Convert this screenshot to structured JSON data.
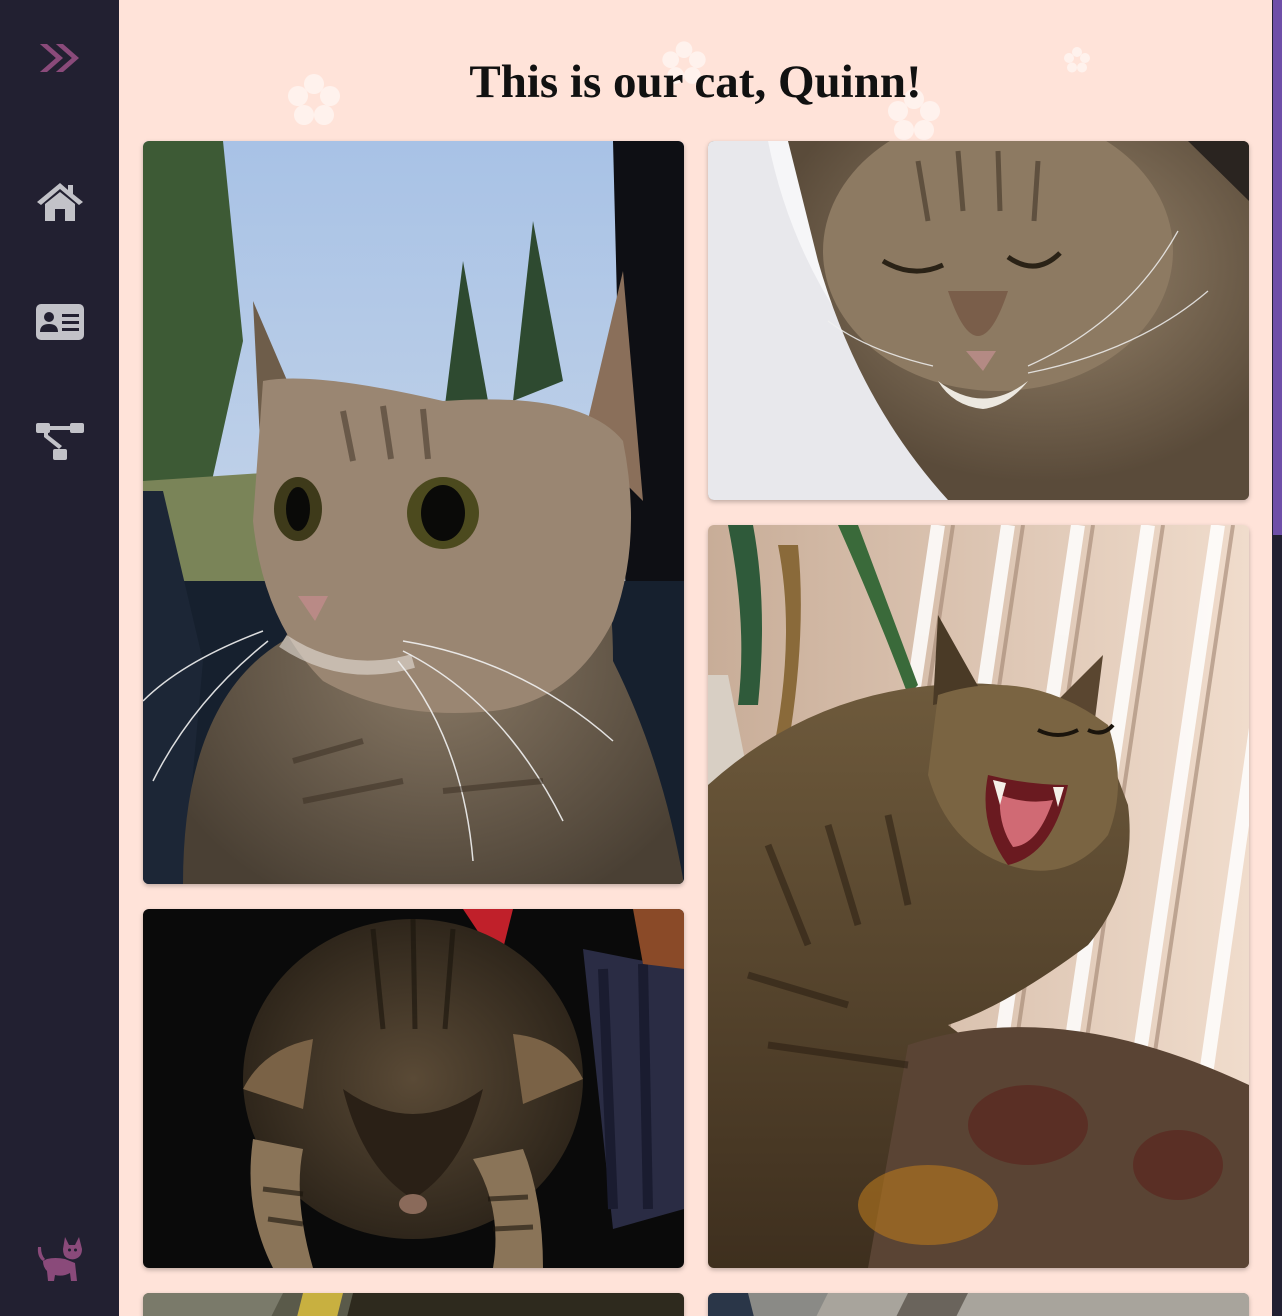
{
  "page": {
    "title": "This is our cat, Quinn!"
  },
  "sidebar": {
    "items": [
      {
        "icon": "expand-chevrons-icon"
      },
      {
        "icon": "home-icon"
      },
      {
        "icon": "id-card-icon"
      },
      {
        "icon": "sitemap-icon"
      },
      {
        "icon": "cat-icon"
      }
    ]
  },
  "gallery": {
    "photos": [
      {
        "subject": "cat-in-car-photo"
      },
      {
        "subject": "cat-sleeping-photo"
      },
      {
        "subject": "cat-yawning-photo"
      },
      {
        "subject": "kitten-looking-down-photo"
      },
      {
        "subject": "cat-photo-5"
      },
      {
        "subject": "cat-photo-6"
      }
    ]
  },
  "colors": {
    "sidebar_bg": "#222031",
    "page_bg": "#ffe3d9",
    "accent_purple": "#8a4a7a",
    "icon_gray": "#c2c2c8",
    "scroll_thumb": "#6f4fa8"
  }
}
